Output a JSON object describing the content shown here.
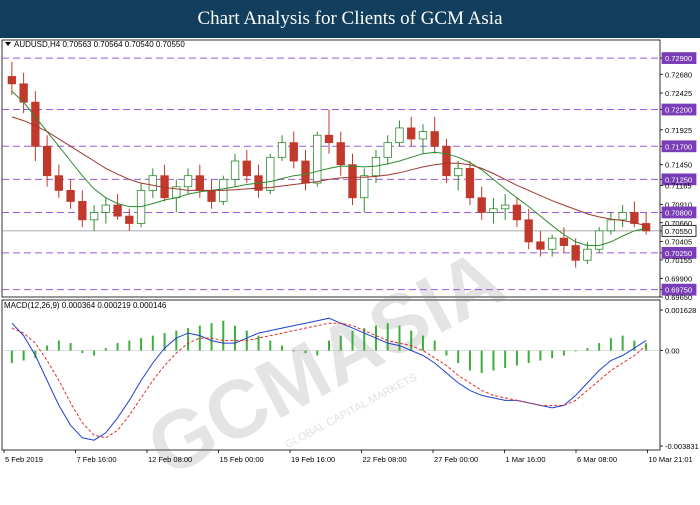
{
  "header": {
    "title": "Chart Analysis for Clients of GCM Asia"
  },
  "chart_data": {
    "type": "line",
    "title": "AUDUSD,H4  0.70563 0.70564 0.70540 0.70550",
    "symbol": "AUDUSD,H4",
    "ohlc": {
      "open": 0.70563,
      "high": 0.70564,
      "low": 0.7054,
      "close": 0.7055
    },
    "price_axis": {
      "ylim": [
        0.6965,
        0.7301
      ],
      "ticks": [
        0.729,
        0.7268,
        0.72425,
        0.722,
        0.71925,
        0.717,
        0.7145,
        0.7125,
        0.71165,
        0.7091,
        0.708,
        0.7066,
        0.7055,
        0.70405,
        0.7025,
        0.70155,
        0.699,
        0.6975,
        0.6965
      ],
      "tick_labels": [
        "0.72900",
        "0.72680",
        "0.72425",
        "0.72200",
        "0.71925",
        "0.71700",
        "0.71450",
        "0.71250",
        "0.71165",
        "0.70910",
        "0.70800",
        "0.70660",
        "0.70550",
        "0.70405",
        "0.70250",
        "0.70155",
        "0.69900",
        "0.69750",
        "0.69650"
      ],
      "highlight_levels": [
        0.729,
        0.722,
        0.717,
        0.7125,
        0.708,
        0.7025,
        0.6975
      ],
      "current_price": 0.7055
    },
    "x_axis": {
      "tick_labels": [
        "5 Feb 2019",
        "7 Feb 16:00",
        "12 Feb 08:00",
        "15 Feb 00:00",
        "19 Feb 16:00",
        "22 Feb 08:00",
        "27 Feb 00:00",
        "1 Mar 16:00",
        "6 Mar 08:00",
        "10 Mar 21:01"
      ]
    },
    "support_resistance_levels": [
      0.729,
      0.722,
      0.717,
      0.7125,
      0.708,
      0.7025,
      0.6975
    ],
    "series": [
      {
        "name": "",
        "kind": "candlestick",
        "values": [
          [
            0.7265,
            0.7285,
            0.724,
            0.7255
          ],
          [
            0.7255,
            0.727,
            0.7215,
            0.723
          ],
          [
            0.723,
            0.7245,
            0.715,
            0.717
          ],
          [
            0.717,
            0.7185,
            0.7115,
            0.713
          ],
          [
            0.713,
            0.7145,
            0.71,
            0.711
          ],
          [
            0.711,
            0.7125,
            0.7085,
            0.7095
          ],
          [
            0.7095,
            0.711,
            0.706,
            0.707
          ],
          [
            0.707,
            0.709,
            0.7055,
            0.708
          ],
          [
            0.708,
            0.71,
            0.7065,
            0.709
          ],
          [
            0.709,
            0.7105,
            0.707,
            0.7075
          ],
          [
            0.7075,
            0.7085,
            0.7055,
            0.7065
          ],
          [
            0.7065,
            0.712,
            0.706,
            0.711
          ],
          [
            0.711,
            0.714,
            0.71,
            0.713
          ],
          [
            0.713,
            0.7145,
            0.7095,
            0.71
          ],
          [
            0.71,
            0.7125,
            0.708,
            0.7115
          ],
          [
            0.7115,
            0.714,
            0.7105,
            0.713
          ],
          [
            0.713,
            0.7145,
            0.71,
            0.711
          ],
          [
            0.711,
            0.7125,
            0.7085,
            0.7095
          ],
          [
            0.7095,
            0.713,
            0.709,
            0.7125
          ],
          [
            0.7125,
            0.716,
            0.7115,
            0.715
          ],
          [
            0.715,
            0.7165,
            0.712,
            0.713
          ],
          [
            0.713,
            0.7145,
            0.71,
            0.711
          ],
          [
            0.711,
            0.716,
            0.7105,
            0.7155
          ],
          [
            0.7155,
            0.7185,
            0.715,
            0.7175
          ],
          [
            0.7175,
            0.719,
            0.714,
            0.715
          ],
          [
            0.715,
            0.7165,
            0.711,
            0.712
          ],
          [
            0.712,
            0.719,
            0.7115,
            0.7185
          ],
          [
            0.7185,
            0.722,
            0.716,
            0.7175
          ],
          [
            0.7175,
            0.719,
            0.713,
            0.7145
          ],
          [
            0.7145,
            0.716,
            0.709,
            0.71
          ],
          [
            0.71,
            0.714,
            0.708,
            0.713
          ],
          [
            0.713,
            0.7165,
            0.712,
            0.7155
          ],
          [
            0.7155,
            0.7185,
            0.7145,
            0.7175
          ],
          [
            0.7175,
            0.7205,
            0.717,
            0.7195
          ],
          [
            0.7195,
            0.721,
            0.717,
            0.718
          ],
          [
            0.718,
            0.72,
            0.716,
            0.719
          ],
          [
            0.719,
            0.721,
            0.716,
            0.717
          ],
          [
            0.717,
            0.718,
            0.712,
            0.713
          ],
          [
            0.713,
            0.715,
            0.711,
            0.714
          ],
          [
            0.714,
            0.715,
            0.709,
            0.71
          ],
          [
            0.71,
            0.7115,
            0.707,
            0.708
          ],
          [
            0.708,
            0.71,
            0.7065,
            0.7085
          ],
          [
            0.7085,
            0.7105,
            0.707,
            0.709
          ],
          [
            0.709,
            0.71,
            0.706,
            0.707
          ],
          [
            0.707,
            0.7085,
            0.703,
            0.704
          ],
          [
            0.704,
            0.7055,
            0.702,
            0.703
          ],
          [
            0.703,
            0.705,
            0.702,
            0.7045
          ],
          [
            0.7045,
            0.706,
            0.7025,
            0.7035
          ],
          [
            0.7035,
            0.7045,
            0.7005,
            0.7015
          ],
          [
            0.7015,
            0.704,
            0.701,
            0.703
          ],
          [
            0.703,
            0.706,
            0.7025,
            0.7055
          ],
          [
            0.7055,
            0.708,
            0.705,
            0.707
          ],
          [
            0.707,
            0.709,
            0.706,
            0.708
          ],
          [
            0.708,
            0.7095,
            0.706,
            0.7065
          ],
          [
            0.7065,
            0.708,
            0.705,
            0.7055
          ]
        ]
      },
      {
        "name": "",
        "kind": "moving-average",
        "color": "#2e8b2e",
        "values": [
          0.7245,
          0.723,
          0.721,
          0.719,
          0.717,
          0.715,
          0.713,
          0.7112,
          0.71,
          0.7092,
          0.7088,
          0.7088,
          0.7092,
          0.7097,
          0.71,
          0.7105,
          0.7108,
          0.711,
          0.7112,
          0.7115,
          0.7118,
          0.712,
          0.7122,
          0.7126,
          0.713,
          0.7132,
          0.7136,
          0.714,
          0.7143,
          0.7143,
          0.7142,
          0.7143,
          0.7146,
          0.715,
          0.7155,
          0.716,
          0.7162,
          0.716,
          0.7155,
          0.7148,
          0.7138,
          0.7125,
          0.7112,
          0.71,
          0.7088,
          0.7075,
          0.7062,
          0.705,
          0.704,
          0.7035,
          0.7035,
          0.704,
          0.7048,
          0.7055,
          0.7058
        ]
      },
      {
        "name": "",
        "kind": "moving-average",
        "color": "#a0382d",
        "values": [
          0.721,
          0.7205,
          0.7198,
          0.719,
          0.718,
          0.717,
          0.716,
          0.715,
          0.714,
          0.7132,
          0.7125,
          0.712,
          0.7117,
          0.7114,
          0.7112,
          0.711,
          0.711,
          0.711,
          0.711,
          0.7111,
          0.7112,
          0.7113,
          0.7114,
          0.7116,
          0.7118,
          0.712,
          0.7122,
          0.7125,
          0.7127,
          0.7128,
          0.7128,
          0.7129,
          0.7131,
          0.7134,
          0.7138,
          0.7142,
          0.7145,
          0.7147,
          0.7147,
          0.7145,
          0.714,
          0.7133,
          0.7125,
          0.7117,
          0.711,
          0.7103,
          0.7096,
          0.709,
          0.7084,
          0.7078,
          0.7074,
          0.7071,
          0.7069,
          0.7066,
          0.7062
        ]
      }
    ],
    "macd": {
      "label": "MACD(12,26,9) 0.000364 0.000219 0.000146",
      "params": [
        12,
        26,
        9
      ],
      "readout": [
        0.000364,
        0.000219,
        0.000146
      ],
      "ylim": [
        -0.003831,
        0.001628
      ],
      "tick_labels": [
        "0.001628",
        "0.00",
        "-0.003831"
      ],
      "histogram": [
        -0.0005,
        -0.0004,
        -0.0003,
        0.0002,
        0.0004,
        0.0003,
        -0.0001,
        -0.0002,
        0.0001,
        0.0003,
        0.0004,
        0.0005,
        0.0006,
        0.0007,
        0.0008,
        0.0009,
        0.001,
        0.0011,
        0.0012,
        0.001,
        0.0008,
        0.0006,
        0.0004,
        0.0002,
        0.0,
        -0.0001,
        -0.0002,
        0.0004,
        0.0006,
        0.0008,
        0.0009,
        0.001,
        0.0011,
        0.001,
        0.0008,
        0.0006,
        0.0004,
        -0.0002,
        -0.0005,
        -0.0008,
        -0.0009,
        -0.0008,
        -0.0007,
        -0.0006,
        -0.0005,
        -0.0004,
        -0.0003,
        -0.0002,
        0.0,
        0.0001,
        0.0003,
        0.0005,
        0.0006,
        0.0004,
        0.0003
      ],
      "macd_line": [
        0.0011,
        0.0006,
        -0.0002,
        -0.0012,
        -0.0022,
        -0.003,
        -0.0035,
        -0.0036,
        -0.0033,
        -0.0027,
        -0.002,
        -0.0012,
        -0.0005,
        0.0001,
        0.0005,
        0.0007,
        0.0006,
        0.0004,
        0.0003,
        0.0003,
        0.0005,
        0.0007,
        0.0008,
        0.0009,
        0.001,
        0.0011,
        0.0012,
        0.0013,
        0.0011,
        0.0009,
        0.0007,
        0.0005,
        0.0003,
        0.0002,
        0.0,
        -0.0002,
        -0.0005,
        -0.0009,
        -0.0013,
        -0.0016,
        -0.0018,
        -0.0019,
        -0.002,
        -0.002,
        -0.0021,
        -0.0022,
        -0.0023,
        -0.0022,
        -0.0018,
        -0.0013,
        -0.0008,
        -0.0004,
        -0.0002,
        0.0001,
        0.0004
      ],
      "signal_line": [
        0.0009,
        0.0007,
        0.0003,
        -0.0004,
        -0.0012,
        -0.0021,
        -0.0029,
        -0.0034,
        -0.0035,
        -0.0032,
        -0.0026,
        -0.0019,
        -0.0012,
        -0.0006,
        -0.0001,
        0.0003,
        0.0005,
        0.0005,
        0.0004,
        0.0004,
        0.0004,
        0.0005,
        0.0006,
        0.0007,
        0.0008,
        0.0009,
        0.001,
        0.0011,
        0.0011,
        0.001,
        0.0008,
        0.0006,
        0.0004,
        0.0003,
        0.0002,
        0.0,
        -0.0003,
        -0.0006,
        -0.001,
        -0.0013,
        -0.0016,
        -0.0018,
        -0.0019,
        -0.002,
        -0.0021,
        -0.0022,
        -0.0022,
        -0.0022,
        -0.002,
        -0.0016,
        -0.0012,
        -0.0008,
        -0.0005,
        -0.0002,
        0.0002
      ]
    },
    "colors": {
      "bull_candle": "#2e8b2e",
      "bear_candle": "#c0392b",
      "level_line": "#9b59d6",
      "level_label_bg": "#7a3db8",
      "macd_histogram": "#3cae3c",
      "macd_line": "#2040d0",
      "signal_line": "#e0302a",
      "banner_bg": "#103e5c"
    }
  },
  "watermark": {
    "text": "GCMASIA",
    "caption": "GLOBAL CAPITAL MARKETS"
  }
}
